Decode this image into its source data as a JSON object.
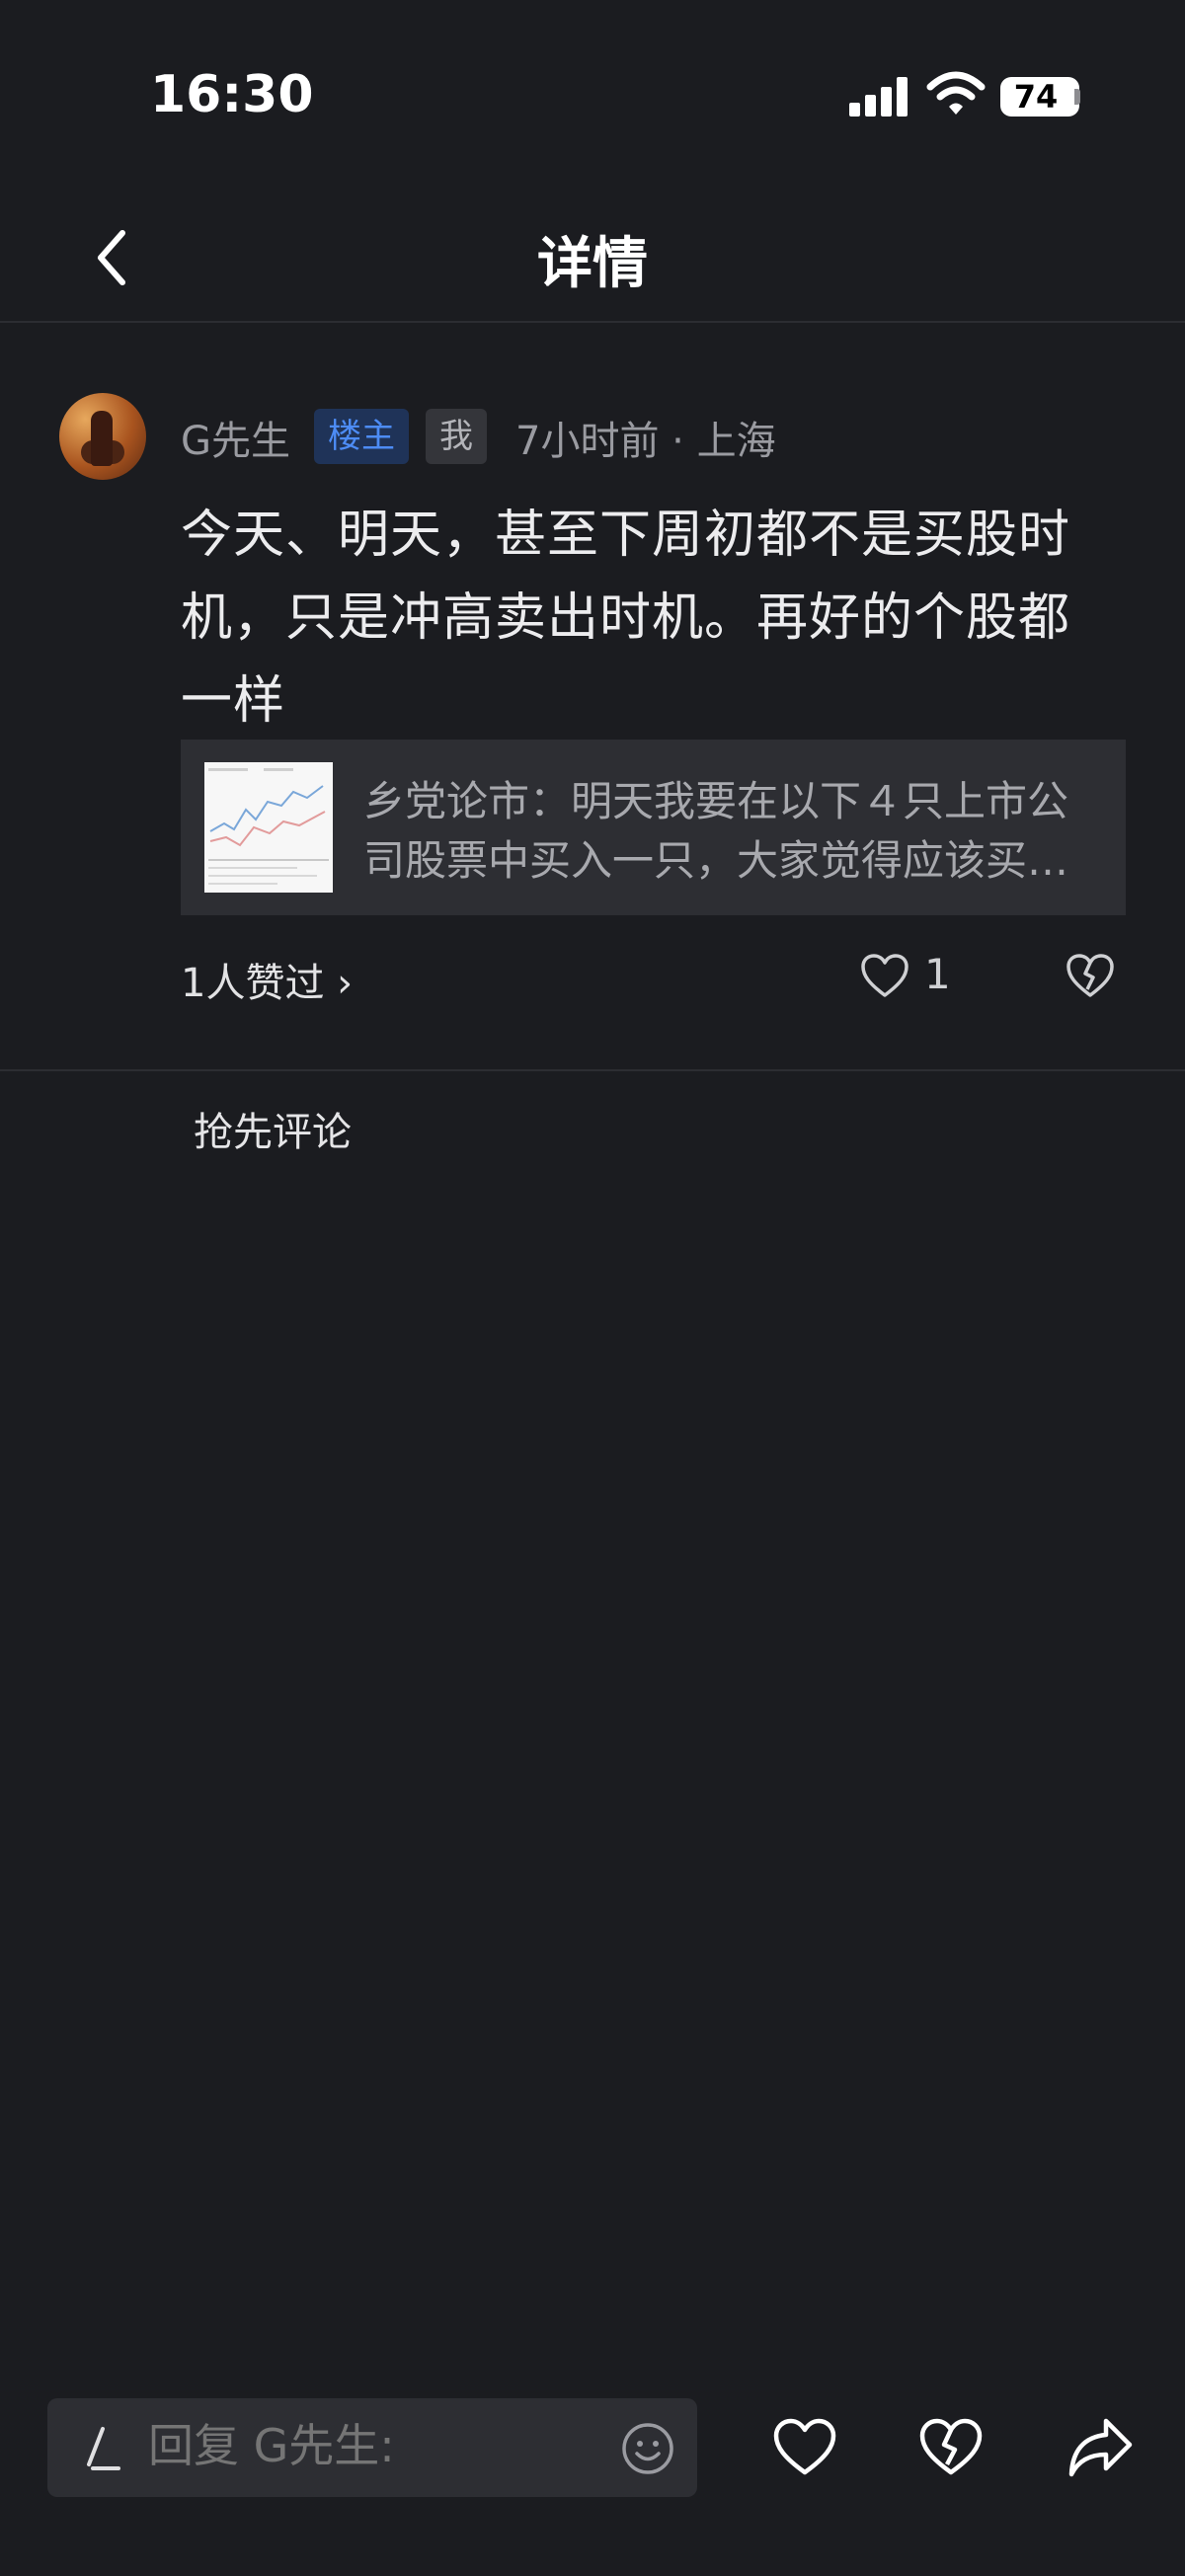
{
  "status_bar": {
    "time": "16:30",
    "battery": "74",
    "icons": [
      "signal-icon",
      "wifi-icon",
      "battery-icon"
    ]
  },
  "header": {
    "title": "详情",
    "back_icon": "chevron-left-icon"
  },
  "post": {
    "author": "G先生",
    "badge_op": "楼主",
    "badge_me": "我",
    "meta": "7小时前 · 上海",
    "text": "今天、明天，甚至下周初都不是买股时机，只是冲高卖出时机。再好的个股都一样",
    "quote": {
      "line1": "乡党论市：明天我要在以下４只上市公",
      "line2": "司股票中买入一只，大家觉得应该买哪只？"
    },
    "likers": "1人赞过 ›",
    "like_count": "1"
  },
  "comments": {
    "empty_text": "抢先评论"
  },
  "bottom_bar": {
    "reply_placeholder": "回复 G先生:",
    "icons": [
      "pen-icon",
      "emoji-icon",
      "heart-icon",
      "broken-heart-icon",
      "share-icon"
    ]
  },
  "colors": {
    "background": "#1b1c20",
    "accent_blue": "#4d8cf5",
    "card": "#2d2e33"
  }
}
